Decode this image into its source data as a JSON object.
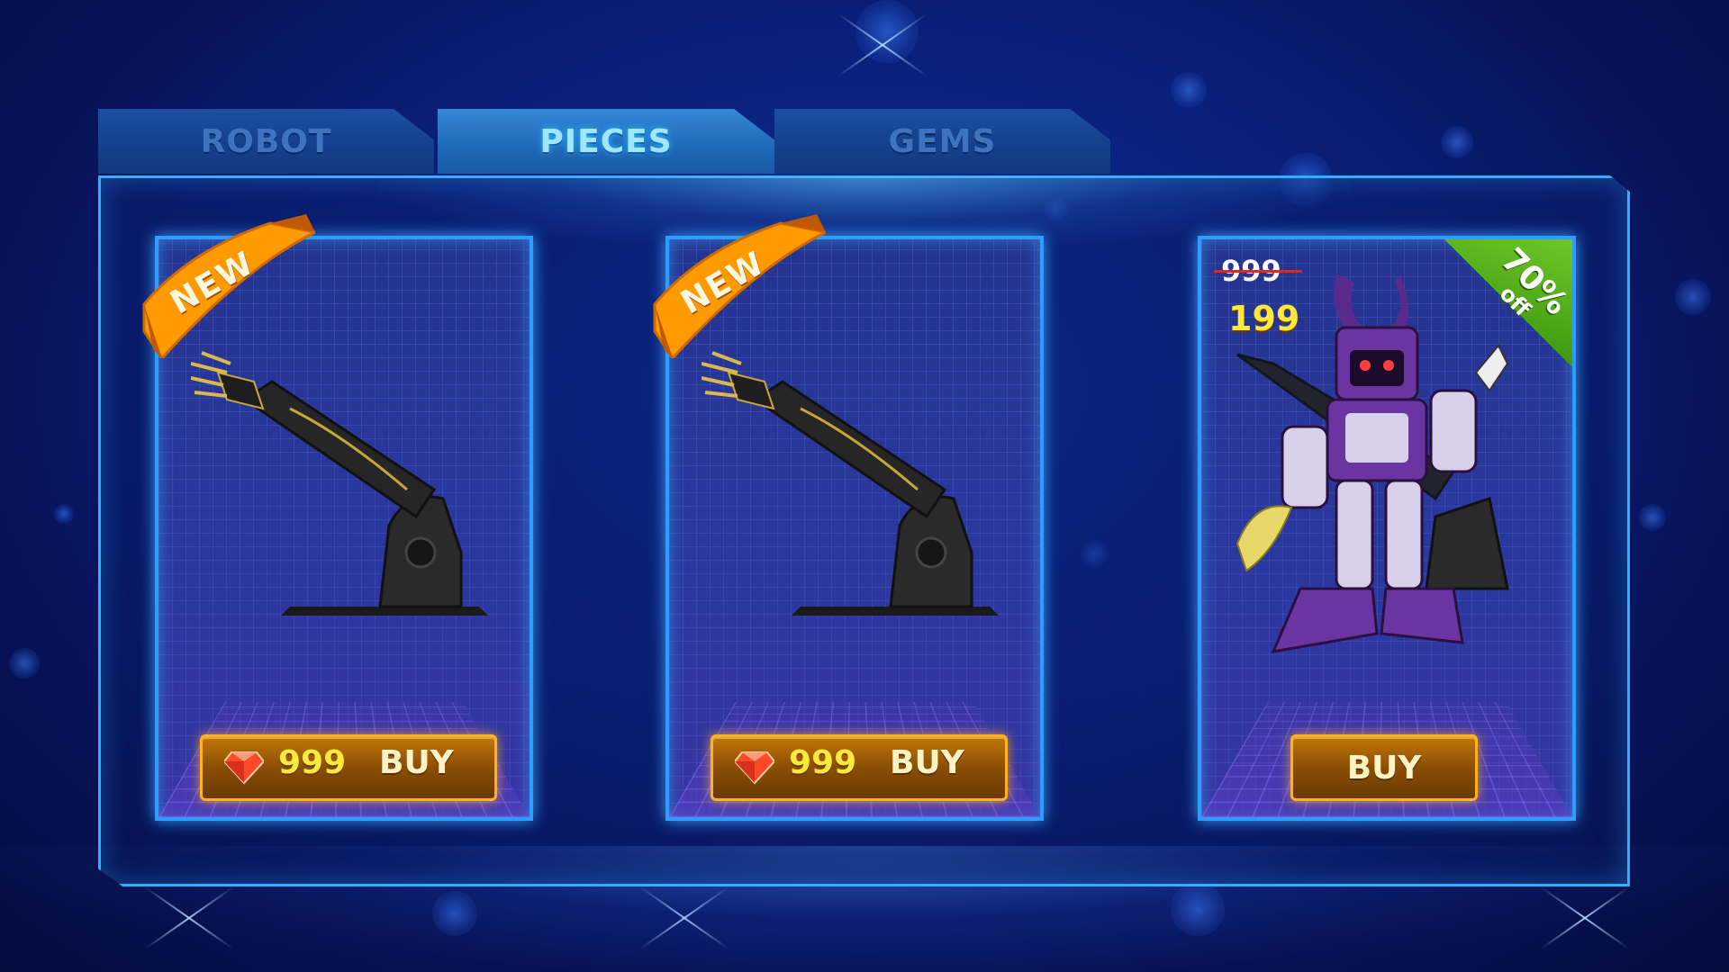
{
  "tabs": [
    {
      "label": "ROBOT",
      "active": false
    },
    {
      "label": "PIECES",
      "active": true
    },
    {
      "label": "GEMS",
      "active": false
    }
  ],
  "items": [
    {
      "badge": "NEW",
      "image": "robotic-arm",
      "price": "999",
      "currency_icon": "gem-icon",
      "buy_label": "BUY"
    },
    {
      "badge": "NEW",
      "image": "robotic-arm",
      "price": "999",
      "currency_icon": "gem-icon",
      "buy_label": "BUY"
    },
    {
      "image": "purple-mech-robot",
      "old_price": "999",
      "new_price": "199",
      "discount": {
        "value": "70%",
        "suffix": "off"
      },
      "buy_label": "BUY"
    }
  ],
  "colors": {
    "background": "#0a1f78",
    "panel_border": "#2fb0ff",
    "tab_active_text": "#9fe7ff",
    "buy_button_border": "#ffb21a",
    "price_yellow": "#ffe93a",
    "new_ribbon": "#ff9a00",
    "discount_green": "#47a214",
    "strike_red": "#e0281c"
  }
}
